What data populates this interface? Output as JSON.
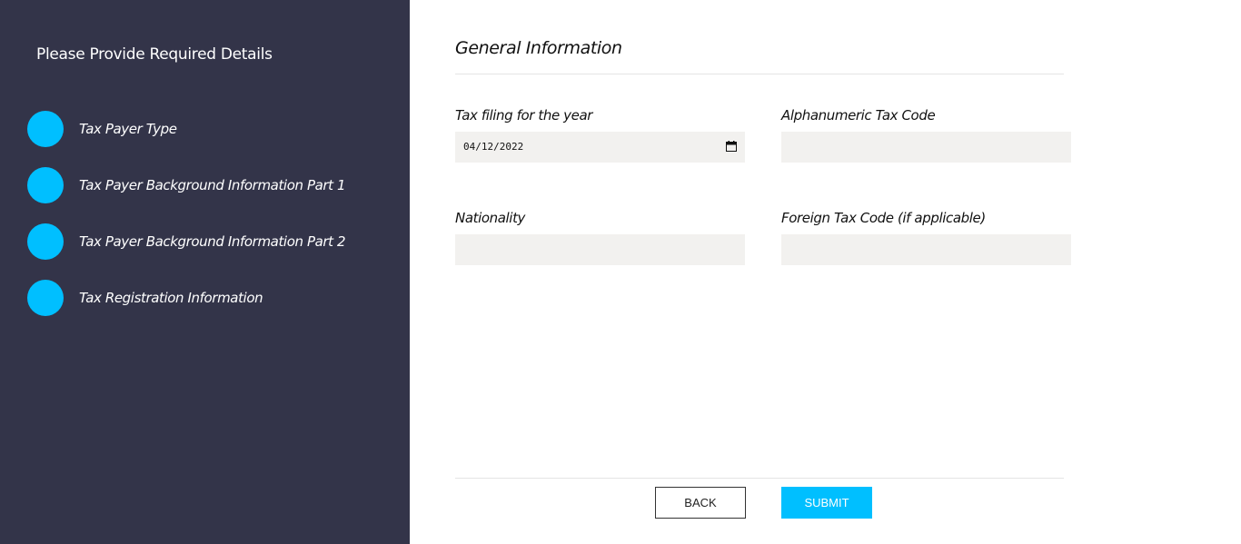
{
  "sidebar": {
    "title": "Please Provide Required Details",
    "steps": [
      {
        "label": "Tax Payer Type"
      },
      {
        "label": "Tax Payer Background Information Part 1"
      },
      {
        "label": "Tax Payer Background Information Part 2"
      },
      {
        "label": "Tax Registration Information"
      }
    ]
  },
  "main": {
    "section_title": "General Information",
    "fields": {
      "tax_year": {
        "label": "Tax filing for the year",
        "value": "04/12/2022"
      },
      "alphanumeric_tax_code": {
        "label": "Alphanumeric Tax Code",
        "value": ""
      },
      "nationality": {
        "label": "Nationality",
        "value": ""
      },
      "foreign_tax_code": {
        "label": "Foreign Tax Code (if applicable)",
        "value": ""
      }
    }
  },
  "buttons": {
    "back": "BACK",
    "submit": "SUBMIT"
  },
  "colors": {
    "sidebar_bg": "#333449",
    "accent": "#00bfff",
    "field_bg": "#f2f1ef"
  },
  "icons": {
    "date_picker": "calendar-icon"
  }
}
